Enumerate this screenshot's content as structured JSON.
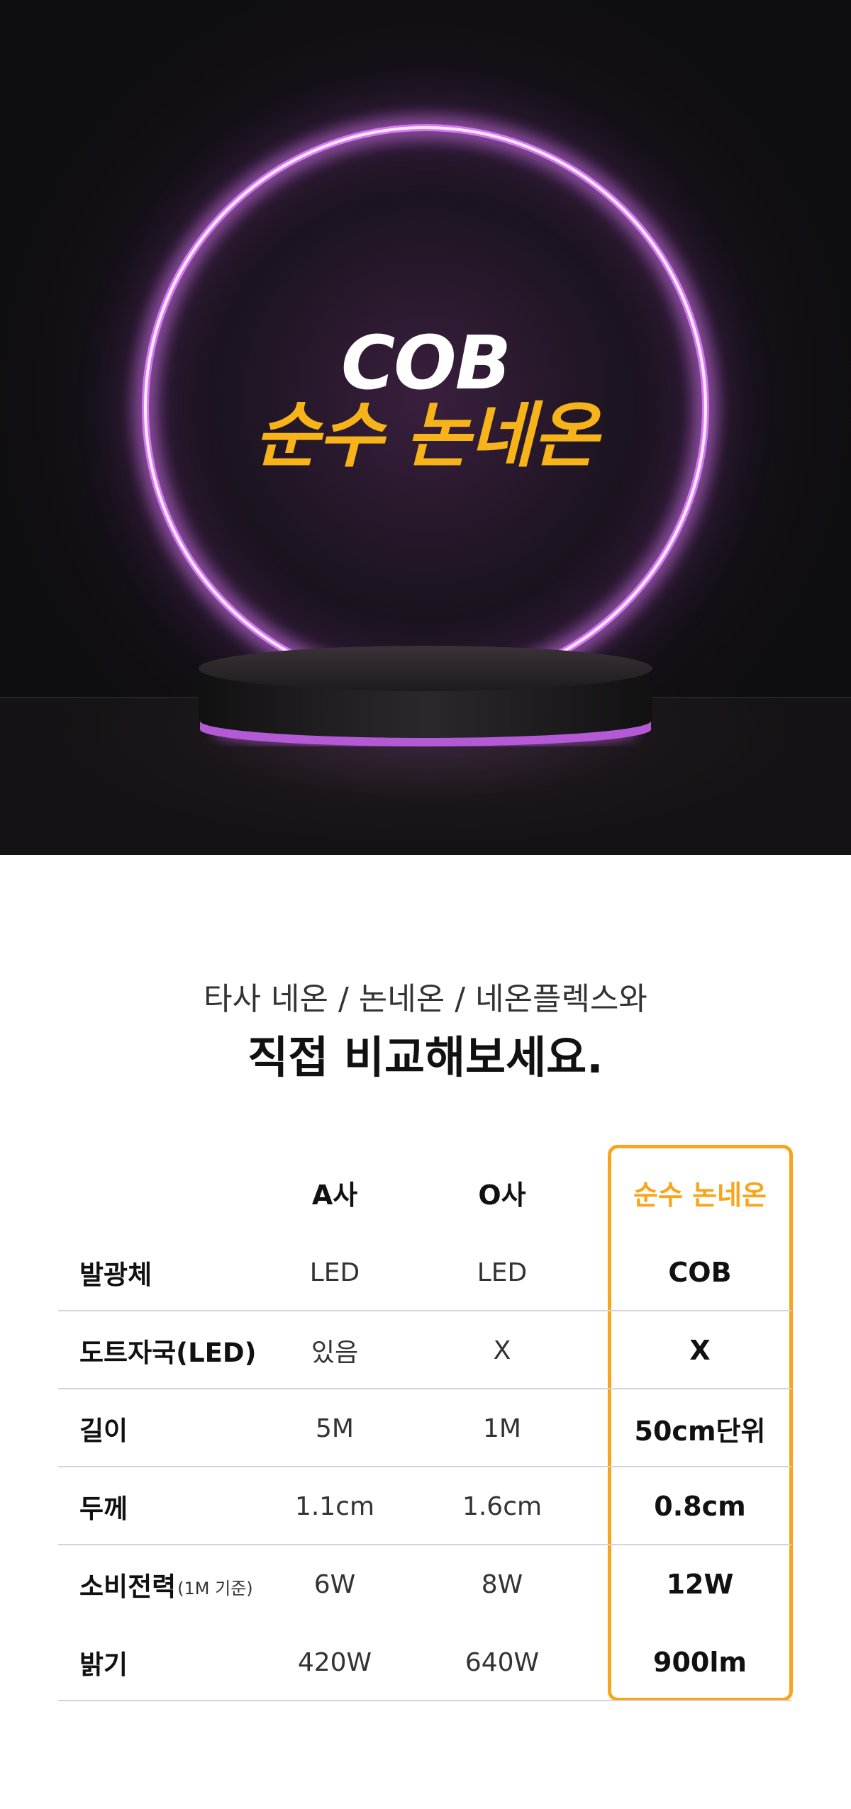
{
  "hero": {
    "title_en": "COB",
    "title_ko": "순수 논네온",
    "accent_color": "#f7b31a",
    "ring_color": "#f2c6ff"
  },
  "comparison": {
    "subtitle": "타사 네온 / 논네온 / 네온플렉스와",
    "headline": "직접 비교해보세요.",
    "columns": [
      "A사",
      "O사",
      "순수 논네온"
    ],
    "highlight_color": "#f7a51c",
    "rows": [
      {
        "label": "발광체",
        "note": "",
        "a": "LED",
        "o": "LED",
        "p": "COB"
      },
      {
        "label": "도트자국(LED)",
        "note": "",
        "a": "있음",
        "o": "X",
        "p": "X"
      },
      {
        "label": "길이",
        "note": "",
        "a": "5M",
        "o": "1M",
        "p": "50cm단위"
      },
      {
        "label": "두께",
        "note": "",
        "a": "1.1cm",
        "o": "1.6cm",
        "p": "0.8cm"
      },
      {
        "label": "소비전력",
        "note": "(1M 기준)",
        "a": "6W",
        "o": "8W",
        "p": "12W"
      },
      {
        "label": "밝기",
        "note": "",
        "a": "420W",
        "o": "640W",
        "p": "900lm"
      }
    ]
  }
}
